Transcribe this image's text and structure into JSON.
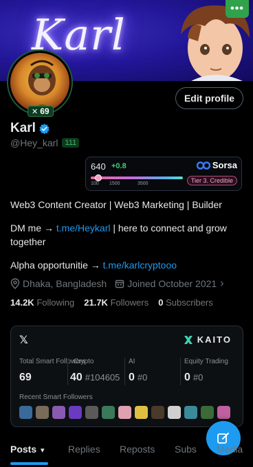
{
  "banner": {
    "title": "Karl",
    "menu_label": "•••"
  },
  "profile": {
    "badge_score": "69",
    "edit_label": "Edit profile",
    "name": "Karl",
    "handle": "@Hey_karl",
    "handle_badge": "111"
  },
  "sorsa": {
    "score": "640",
    "delta": "+0.8",
    "brand": "Sorsa",
    "ticks": [
      "100",
      "1500",
      "3500"
    ],
    "tier": "Tier 3. Credible",
    "level": 0.08
  },
  "bio": {
    "line1": "Web3 Content Creator | Web3 Marketing | Builder",
    "dm_prefix": "DM me →",
    "dm_link": "t.me/Heykarl",
    "dm_suffix": "| here to connect and grow together",
    "alpha_prefix": "Alpha opportunitie →",
    "alpha_link": "t.me/karlcryptooo"
  },
  "meta": {
    "location": "Dhaka, Bangladesh",
    "joined": "Joined October 2021"
  },
  "follows": {
    "following_count": "14.2K",
    "following_label": "Following",
    "followers_count": "21.7K",
    "followers_label": "Followers",
    "subs_count": "0",
    "subs_label": "Subscribers"
  },
  "kaito": {
    "x_label": "𝕏",
    "brand": "KAITO",
    "stats": [
      {
        "label": "Total Smart Followers",
        "value": "69",
        "sub": ""
      },
      {
        "label": "Crypto",
        "value": "40",
        "sub": "#104605"
      },
      {
        "label": "AI",
        "value": "0",
        "sub": "#0"
      },
      {
        "label": "Equity Trading",
        "value": "0",
        "sub": "#0"
      }
    ],
    "recent_label": "Recent Smart Followers",
    "recent_colors": [
      "#3a6a9a",
      "#7a6a5a",
      "#8a5ab0",
      "#6a3ac0",
      "#5a5a5a",
      "#3a7a5a",
      "#e0a0b0",
      "#e0c040",
      "#4a3a2a",
      "#d0d0d0",
      "#3a8a9a",
      "#3a6a3a",
      "#c060a0"
    ]
  },
  "tabs": [
    "Posts",
    "Replies",
    "Reposts",
    "Subs",
    "Media"
  ],
  "colors": {
    "accent": "#1d9bf0",
    "background": "#000000"
  }
}
